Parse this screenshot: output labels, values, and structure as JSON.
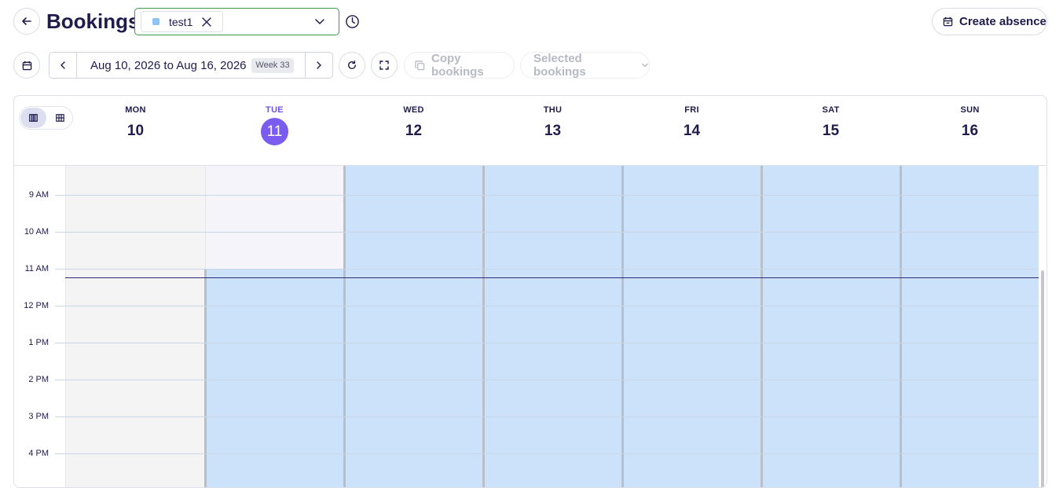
{
  "header": {
    "title": "Bookings",
    "resource_chip_label": "test1",
    "create_absence_label": "Create absence"
  },
  "toolbar": {
    "date_range": "Aug 10, 2026 to Aug 16, 2026",
    "week_badge": "Week 33",
    "copy_bookings_label": "Copy bookings",
    "selected_bookings_label": "Selected bookings"
  },
  "calendar": {
    "days": [
      {
        "dow": "MON",
        "num": "10"
      },
      {
        "dow": "TUE",
        "num": "11",
        "today": true
      },
      {
        "dow": "WED",
        "num": "12"
      },
      {
        "dow": "THU",
        "num": "13"
      },
      {
        "dow": "FRI",
        "num": "14"
      },
      {
        "dow": "SAT",
        "num": "15"
      },
      {
        "dow": "SUN",
        "num": "16"
      }
    ],
    "hours": [
      "9 AM",
      "10 AM",
      "11 AM",
      "12 PM",
      "1 PM",
      "2 PM",
      "3 PM",
      "4 PM"
    ]
  },
  "colors": {
    "accent": "#7b5cf0",
    "chip_square": "#8ec3f2",
    "booking_fill": "#cce2fb",
    "now_line": "#2d2875",
    "primary_border": "#3a9b4d"
  },
  "icons": {
    "back": "arrow-left-icon",
    "history": "clock-icon",
    "calendar": "calendar-icon",
    "refresh": "refresh-icon",
    "fullscreen": "expand-icon",
    "copy": "copy-icon"
  }
}
